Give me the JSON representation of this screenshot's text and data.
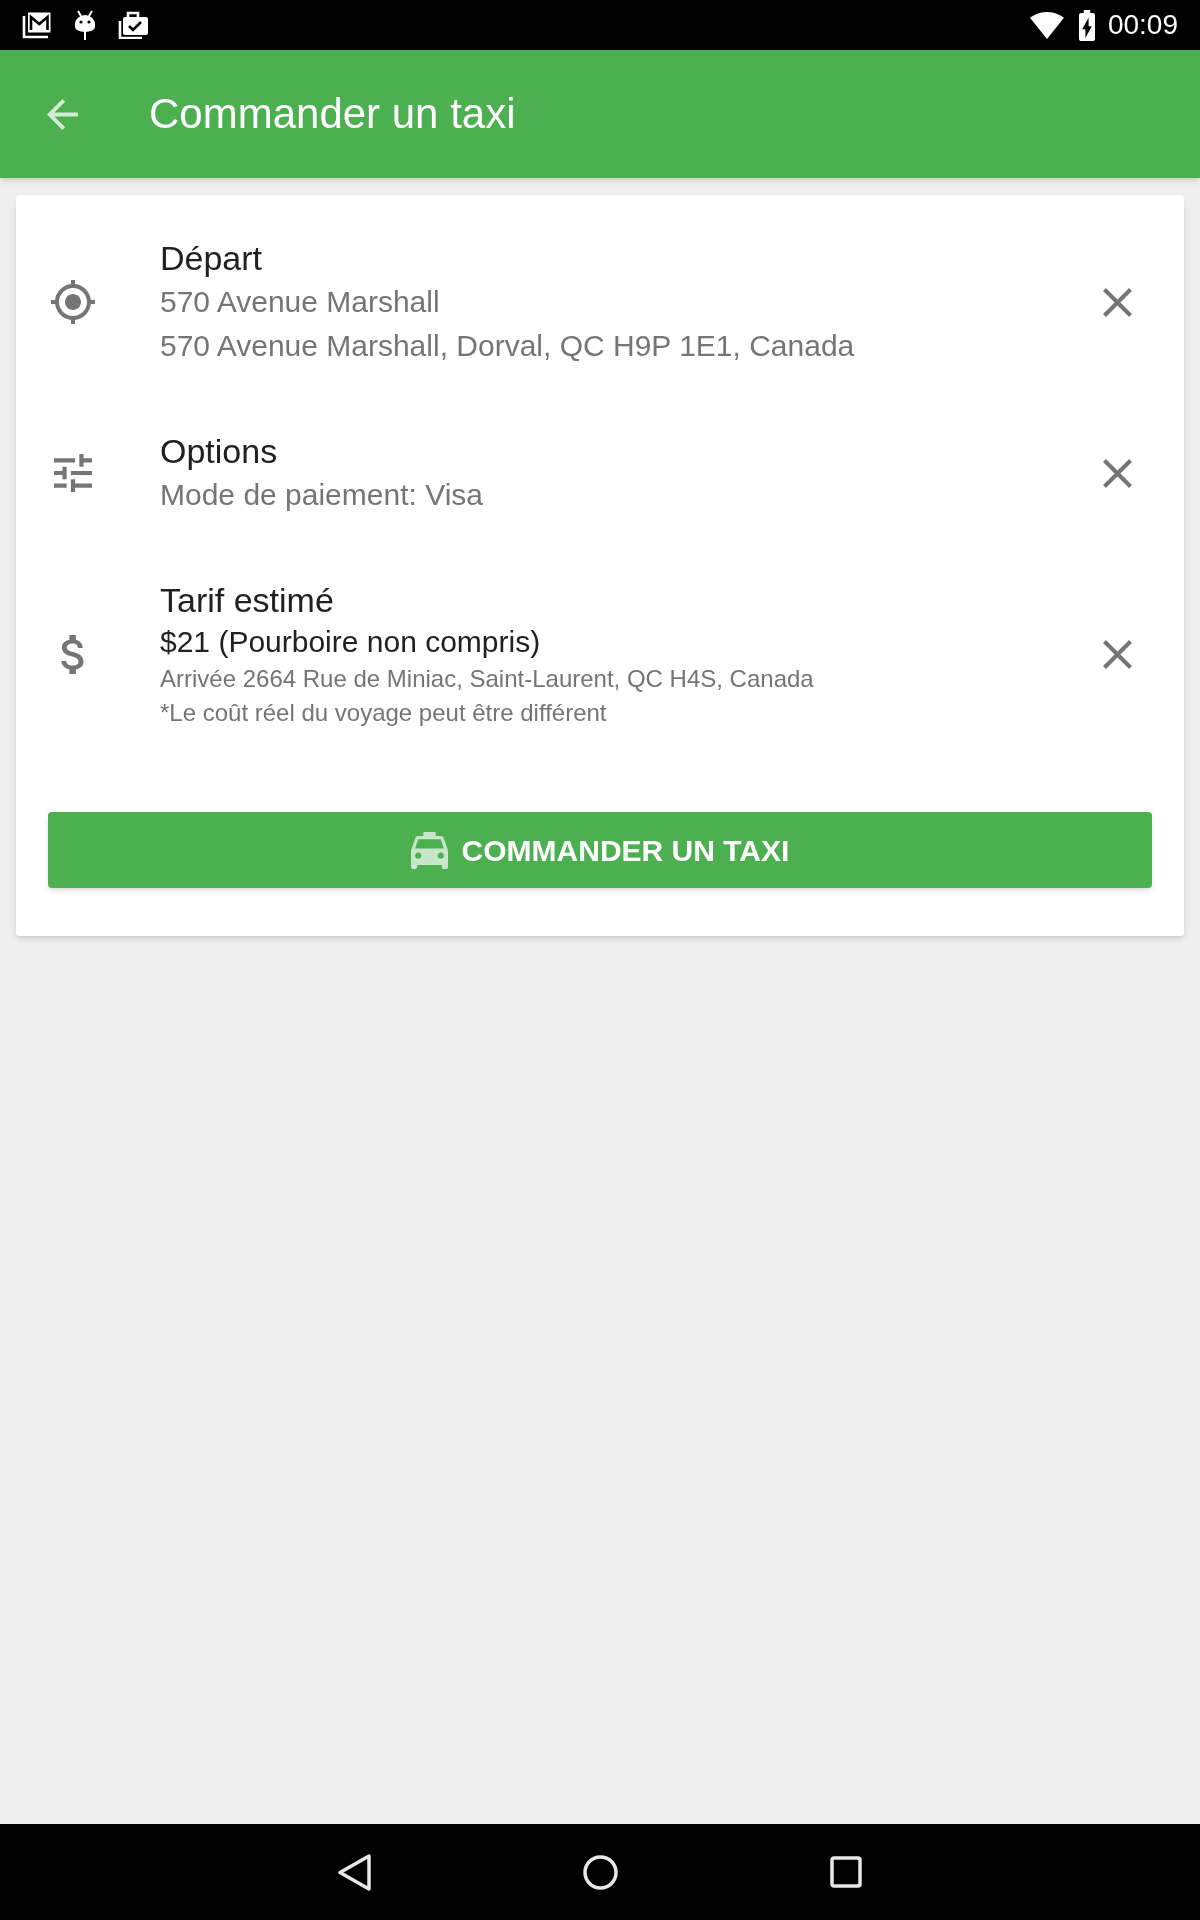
{
  "status_bar": {
    "time": "00:09"
  },
  "app_bar": {
    "title": "Commander un taxi"
  },
  "card": {
    "rows": [
      {
        "kind": "location",
        "title": "Départ",
        "lines": [
          {
            "kind": "secondary",
            "text": "570 Avenue Marshall"
          },
          {
            "kind": "secondary",
            "text": "570 Avenue Marshall, Dorval, QC H9P 1E1, Canada"
          }
        ]
      },
      {
        "kind": "options",
        "title": "Options",
        "lines": [
          {
            "kind": "secondary",
            "text": "Mode de paiement: Visa"
          }
        ]
      },
      {
        "kind": "fare",
        "title": "Tarif estimé",
        "lines": [
          {
            "kind": "price",
            "text": "$21 (Pourboire non compris)"
          },
          {
            "kind": "note",
            "text": "Arrivée 2664 Rue de Miniac, Saint-Laurent, QC H4S, Canada"
          },
          {
            "kind": "note",
            "text": "*Le coût réel du voyage peut être différent"
          }
        ]
      }
    ],
    "button": {
      "label": "COMMANDER UN TAXI"
    }
  }
}
